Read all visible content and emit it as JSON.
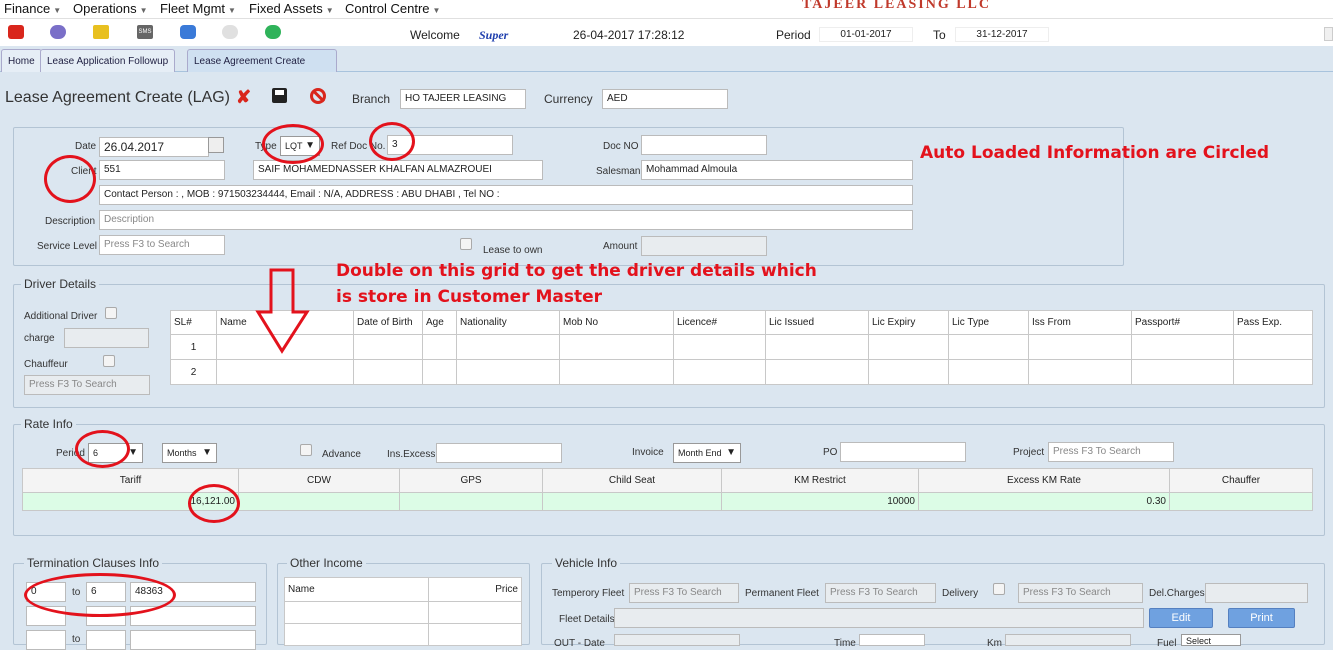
{
  "menu": [
    "Finance",
    "Operations",
    "Fleet Mgmt",
    "Fixed Assets",
    "Control Centre"
  ],
  "brand": "TAJEER LEASING LLC",
  "header": {
    "welcome_label": "Welcome",
    "user": "Super",
    "datetime": "26-04-2017 17:28:12",
    "period_label": "Period",
    "period_from": "01-01-2017",
    "to_label": "To",
    "period_to": "31-12-2017"
  },
  "tabs": [
    "Home",
    "Lease Application Followup",
    "Lease Agreement Create"
  ],
  "page": {
    "title": "Lease Agreement Create (LAG)",
    "branch_label": "Branch",
    "branch_value": "HO TAJEER LEASING",
    "currency_label": "Currency",
    "currency_value": "AED"
  },
  "form": {
    "date_label": "Date",
    "date_value": "26.04.2017",
    "type_label": "Type",
    "type_value": "LQT",
    "refdoc_label": "Ref Doc No.",
    "refdoc_value": "3",
    "docno_label": "Doc NO",
    "docno_value": "",
    "client_label": "Client",
    "client_code": "551",
    "client_name": "SAIF MOHAMEDNASSER KHALFAN ALMAZROUEI",
    "salesman_label": "Salesman",
    "salesman_value": "Mohammad Almoula",
    "contact": "Contact Person : , MOB : 971503234444, Email : N/A, ADDRESS : ABU DHABI , Tel NO :",
    "description_label": "Description",
    "description_placeholder": "Description",
    "service_label": "Service Level",
    "service_placeholder": "Press F3 to Search",
    "lease_to_own_label": "Lease to own",
    "amount_label": "Amount",
    "amount_value": ""
  },
  "annotations": {
    "auto_loaded": "Auto Loaded Information are Circled",
    "double_click_1": "Double on this grid to get the driver details which",
    "double_click_2": "is store in Customer Master"
  },
  "driver": {
    "legend": "Driver Details",
    "additional_label": "Additional Driver",
    "charge_label": "charge",
    "chauffeur_label": "Chauffeur",
    "chauffeur_placeholder": "Press F3 To Search",
    "columns": [
      "SL#",
      "Name",
      "Date of Birth",
      "Age",
      "Nationality",
      "Mob No",
      "Licence#",
      "Lic Issued",
      "Lic Expiry",
      "Lic Type",
      "Iss From",
      "Passport#",
      "Pass Exp."
    ],
    "rows": [
      [
        "1",
        "",
        "",
        "",
        "",
        "",
        "",
        "",
        "",
        "",
        "",
        "",
        ""
      ],
      [
        "2",
        "",
        "",
        "",
        "",
        "",
        "",
        "",
        "",
        "",
        "",
        "",
        ""
      ]
    ]
  },
  "rate": {
    "legend": "Rate Info",
    "period_label": "Period",
    "period_value": "6",
    "unit_value": "Months",
    "advance_label": "Advance",
    "insexcess_label": "Ins.Excess",
    "invoice_label": "Invoice",
    "invoice_value": "Month End",
    "po_label": "PO",
    "project_label": "Project",
    "project_placeholder": "Press F3 To Search",
    "columns": [
      "Tariff",
      "CDW",
      "GPS",
      "Child Seat",
      "KM Restrict",
      "Excess KM Rate",
      "Chauffer"
    ],
    "row": [
      "16,121.00",
      "",
      "",
      "",
      "10000",
      "0.30",
      ""
    ]
  },
  "termination": {
    "legend": "Termination Clauses Info",
    "to_label": "to",
    "rows": [
      [
        "0",
        "6",
        "48363"
      ],
      [
        "",
        "",
        ""
      ],
      [
        "",
        "",
        ""
      ]
    ]
  },
  "other_income": {
    "legend": "Other Income",
    "name_col": "Name",
    "price_col": "Price"
  },
  "vehicle": {
    "legend": "Vehicle Info",
    "temp_fleet_label": "Temperory Fleet",
    "temp_fleet_placeholder": "Press F3 To Search",
    "perm_fleet_label": "Permanent Fleet",
    "perm_fleet_placeholder": "Press F3 To Search",
    "delivery_label": "Delivery",
    "delivery_placeholder": "Press F3 To Search",
    "delcharges_label": "Del.Charges",
    "fleet_details_label": "Fleet Details",
    "edit_button": "Edit",
    "print_button": "Print",
    "out_label": "OUT - Date",
    "time_label": "Time",
    "km_label": "Km",
    "fuel_label": "Fuel",
    "fuel_value": "Select"
  },
  "colors": {
    "annotation_red": "#e3121c",
    "tab_active": "#cfe0f1",
    "rate_row": "#dcfce6"
  }
}
